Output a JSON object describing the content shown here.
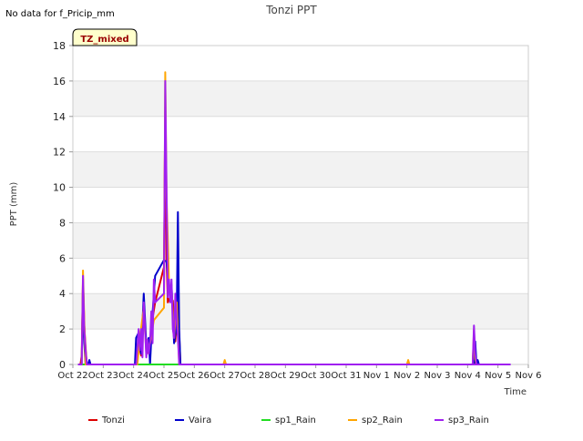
{
  "note": "No data for f_Pricip_mm",
  "chart_data": {
    "type": "line",
    "title": "Tonzi PPT",
    "xlabel": "Time",
    "ylabel": "PPT (mm)",
    "badge": "TZ_mixed",
    "ylim": [
      0,
      18
    ],
    "yticks": [
      0,
      2,
      4,
      6,
      8,
      10,
      12,
      14,
      16,
      18
    ],
    "xlim": [
      "2023-10-22",
      "2023-11-06"
    ],
    "xtick_labels": [
      "Oct 22",
      "Oct 23",
      "Oct 24",
      "Oct 25",
      "Oct 26",
      "Oct 27",
      "Oct 28",
      "Oct 29",
      "Oct 30",
      "Oct 31",
      "Nov 1",
      "Nov 2",
      "Nov 3",
      "Nov 4",
      "Nov 5",
      "Nov 6"
    ],
    "grid": true,
    "legend_position": "bottom",
    "series": [
      {
        "name": "Tonzi",
        "color": "#dd0000",
        "points": [
          [
            "Oct 22 06:00",
            0
          ],
          [
            "Oct 22 07:00",
            0.5
          ],
          [
            "Oct 22 08:00",
            4.8
          ],
          [
            "Oct 22 09:00",
            2.2
          ],
          [
            "Oct 22 10:00",
            1.0
          ],
          [
            "Oct 22 11:00",
            0
          ],
          [
            "Oct 24 02:00",
            0
          ],
          [
            "Oct 24 04:00",
            1.2
          ],
          [
            "Oct 24 06:00",
            0.5
          ],
          [
            "Oct 24 08:00",
            3.5
          ],
          [
            "Oct 24 10:00",
            1.0
          ],
          [
            "Oct 24 12:00",
            0.6
          ],
          [
            "Oct 24 15:00",
            2.6
          ],
          [
            "Oct 24 17:00",
            3.5
          ],
          [
            "Oct 25 00:00",
            5.5
          ],
          [
            "Oct 25 01:00",
            14.5
          ],
          [
            "Oct 25 02:00",
            6.0
          ],
          [
            "Oct 25 03:00",
            3.5
          ],
          [
            "Oct 25 05:00",
            3.8
          ],
          [
            "Oct 25 07:00",
            3.6
          ],
          [
            "Oct 25 09:00",
            1.3
          ],
          [
            "Oct 25 11:00",
            3.5
          ],
          [
            "Oct 25 13:00",
            0
          ],
          [
            "Nov 4 04:00",
            0
          ],
          [
            "Nov 4 05:00",
            1.6
          ],
          [
            "Nov 4 06:00",
            0
          ]
        ]
      },
      {
        "name": "Vaira",
        "color": "#0000cc",
        "points": [
          [
            "Oct 22 07:00",
            0
          ],
          [
            "Oct 22 08:00",
            4.6
          ],
          [
            "Oct 22 09:00",
            1.2
          ],
          [
            "Oct 22 10:00",
            0
          ],
          [
            "Oct 22 12:00",
            0
          ],
          [
            "Oct 22 13:00",
            0.25
          ],
          [
            "Oct 22 14:00",
            0
          ],
          [
            "Oct 24 01:00",
            0
          ],
          [
            "Oct 24 02:00",
            1.5
          ],
          [
            "Oct 24 04:00",
            1.8
          ],
          [
            "Oct 24 06:00",
            0.6
          ],
          [
            "Oct 24 08:00",
            4.0
          ],
          [
            "Oct 24 10:00",
            1.1
          ],
          [
            "Oct 24 12:00",
            1.5
          ],
          [
            "Oct 24 13:00",
            0
          ],
          [
            "Oct 24 15:00",
            2.9
          ],
          [
            "Oct 24 17:00",
            5.0
          ],
          [
            "Oct 25 00:00",
            5.9
          ],
          [
            "Oct 25 02:00",
            5.8
          ],
          [
            "Oct 25 04:00",
            4.2
          ],
          [
            "Oct 25 06:00",
            4.5
          ],
          [
            "Oct 25 08:00",
            1.2
          ],
          [
            "Oct 25 10:00",
            2.2
          ],
          [
            "Oct 25 11:00",
            8.6
          ],
          [
            "Oct 25 12:00",
            2.0
          ],
          [
            "Oct 25 13:00",
            0
          ],
          [
            "Nov 4 05:00",
            0
          ],
          [
            "Nov 4 06:00",
            1.3
          ],
          [
            "Nov 4 07:00",
            0
          ],
          [
            "Nov 4 08:00",
            0.25
          ],
          [
            "Nov 4 09:00",
            0
          ]
        ]
      },
      {
        "name": "sp1_Rain",
        "color": "#22dd22",
        "points": [
          [
            "Oct 22 04:00",
            0
          ],
          [
            "Oct 25 14:00",
            0
          ],
          [
            "Nov 5 00:00",
            0
          ]
        ]
      },
      {
        "name": "sp2_Rain",
        "color": "#ffa500",
        "points": [
          [
            "Oct 22 07:00",
            0
          ],
          [
            "Oct 22 08:00",
            5.3
          ],
          [
            "Oct 22 09:00",
            2.5
          ],
          [
            "Oct 22 10:00",
            0
          ],
          [
            "Oct 24 03:00",
            0
          ],
          [
            "Oct 24 05:00",
            1.5
          ],
          [
            "Oct 24 08:00",
            3.2
          ],
          [
            "Oct 24 10:00",
            0.6
          ],
          [
            "Oct 24 13:00",
            1.2
          ],
          [
            "Oct 24 16:00",
            2.5
          ],
          [
            "Oct 25 00:00",
            3.2
          ],
          [
            "Oct 25 01:00",
            16.5
          ],
          [
            "Oct 25 02:00",
            9.5
          ],
          [
            "Oct 25 04:00",
            4.5
          ],
          [
            "Oct 25 06:00",
            4.2
          ],
          [
            "Oct 25 08:00",
            1.5
          ],
          [
            "Oct 25 10:00",
            3.5
          ],
          [
            "Oct 25 12:00",
            0
          ],
          [
            "Oct 26 23:00",
            0
          ],
          [
            "Oct 27 00:00",
            0.25
          ],
          [
            "Oct 27 01:00",
            0
          ],
          [
            "Nov 2 00:00",
            0
          ],
          [
            "Nov 2 01:00",
            0.25
          ],
          [
            "Nov 2 02:00",
            0
          ],
          [
            "Nov 4 04:00",
            0
          ],
          [
            "Nov 4 05:00",
            2.0
          ],
          [
            "Nov 4 06:00",
            0.3
          ],
          [
            "Nov 4 07:00",
            0
          ]
        ]
      },
      {
        "name": "sp3_Rain",
        "color": "#a020f0",
        "points": [
          [
            "Oct 22 04:00",
            0
          ],
          [
            "Oct 22 07:00",
            0
          ],
          [
            "Oct 22 08:00",
            5.0
          ],
          [
            "Oct 22 09:00",
            2.0
          ],
          [
            "Oct 22 10:00",
            0.8
          ],
          [
            "Oct 22 11:00",
            0
          ],
          [
            "Oct 24 02:00",
            0
          ],
          [
            "Oct 24 04:00",
            2.0
          ],
          [
            "Oct 24 05:00",
            0.8
          ],
          [
            "Oct 24 06:00",
            2.0
          ],
          [
            "Oct 24 07:00",
            0.4
          ],
          [
            "Oct 24 08:00",
            3.5
          ],
          [
            "Oct 24 09:00",
            2.0
          ],
          [
            "Oct 24 10:00",
            0.4
          ],
          [
            "Oct 24 11:00",
            1.4
          ],
          [
            "Oct 24 12:00",
            0.6
          ],
          [
            "Oct 24 13:00",
            1.2
          ],
          [
            "Oct 24 14:00",
            3.0
          ],
          [
            "Oct 24 15:00",
            1.2
          ],
          [
            "Oct 24 16:00",
            4.8
          ],
          [
            "Oct 24 17:00",
            3.5
          ],
          [
            "Oct 25 00:00",
            4.0
          ],
          [
            "Oct 25 01:00",
            16.0
          ],
          [
            "Oct 25 02:00",
            10.0
          ],
          [
            "Oct 25 03:00",
            3.8
          ],
          [
            "Oct 25 04:00",
            4.8
          ],
          [
            "Oct 25 05:00",
            3.5
          ],
          [
            "Oct 25 06:00",
            4.8
          ],
          [
            "Oct 25 07:00",
            2.0
          ],
          [
            "Oct 25 08:00",
            1.5
          ],
          [
            "Oct 25 09:00",
            4.0
          ],
          [
            "Oct 25 10:00",
            2.5
          ],
          [
            "Oct 25 11:00",
            1.5
          ],
          [
            "Oct 25 12:00",
            0
          ],
          [
            "Nov 5 10:00",
            0
          ],
          [
            "Nov 4 04:00",
            0
          ],
          [
            "Nov 4 05:00",
            2.2
          ],
          [
            "Nov 4 06:00",
            0.6
          ],
          [
            "Nov 4 07:00",
            0
          ]
        ]
      }
    ]
  }
}
